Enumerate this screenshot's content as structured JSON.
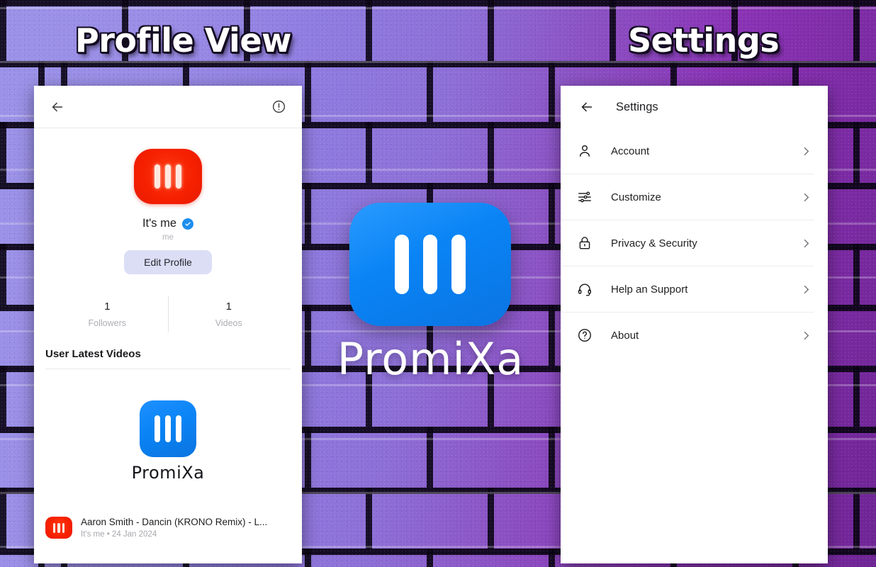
{
  "captions": {
    "left": "Profile View",
    "right": "Settings"
  },
  "brand": {
    "name": "PromiXa",
    "logo_icon": "promixa-bars-logo",
    "blue": "#0A84F5",
    "red": "#F52000"
  },
  "profile_panel": {
    "app_bar": {
      "back_icon": "back-arrow-icon",
      "report_icon": "exclamation-circle-icon"
    },
    "avatar_icon": "promixa-bars-avatar",
    "display_name": "It's me",
    "verified_icon": "verified-badge-icon",
    "handle": "me",
    "edit_button": "Edit Profile",
    "stats": [
      {
        "value": "1",
        "label": "Followers"
      },
      {
        "value": "1",
        "label": "Videos"
      }
    ],
    "section_title": "User Latest Videos",
    "promo": {
      "logo_icon": "promixa-bars-logo",
      "wordmark": "PromiXa"
    },
    "videos": [
      {
        "thumb_icon": "promixa-bars-thumb",
        "title": "Aaron Smith - Dancin (KRONO Remix) - L...",
        "subtitle": "It's me • 24 Jan 2024"
      }
    ]
  },
  "settings_panel": {
    "app_bar": {
      "back_icon": "back-arrow-icon",
      "title": "Settings"
    },
    "items": [
      {
        "label": "Account",
        "icon": "person-icon",
        "chevron": "chevron-right-icon"
      },
      {
        "label": "Customize",
        "icon": "sliders-icon",
        "chevron": "chevron-right-icon"
      },
      {
        "label": "Privacy & Security",
        "icon": "lock-icon",
        "chevron": "chevron-right-icon"
      },
      {
        "label": "Help an Support",
        "icon": "headset-icon",
        "chevron": "chevron-right-icon"
      },
      {
        "label": "About",
        "icon": "question-circle-icon",
        "chevron": "chevron-right-icon"
      }
    ]
  }
}
